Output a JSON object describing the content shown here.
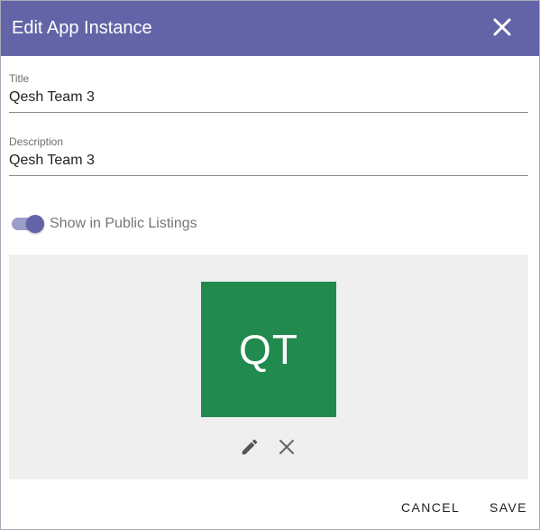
{
  "dialog": {
    "title": "Edit App Instance",
    "close_icon": "close-icon"
  },
  "form": {
    "title_label": "Title",
    "title_value": "Qesh Team 3",
    "description_label": "Description",
    "description_value": "Qesh Team 3",
    "public_toggle": {
      "label": "Show in Public Listings",
      "checked": true
    }
  },
  "app_image": {
    "initials": "QT",
    "background_color": "#218a4e",
    "edit_icon": "pencil-icon",
    "remove_icon": "close-icon"
  },
  "actions": {
    "cancel_label": "CANCEL",
    "save_label": "SAVE"
  },
  "colors": {
    "accent": "#6264a7",
    "panel_background": "#efefef"
  }
}
